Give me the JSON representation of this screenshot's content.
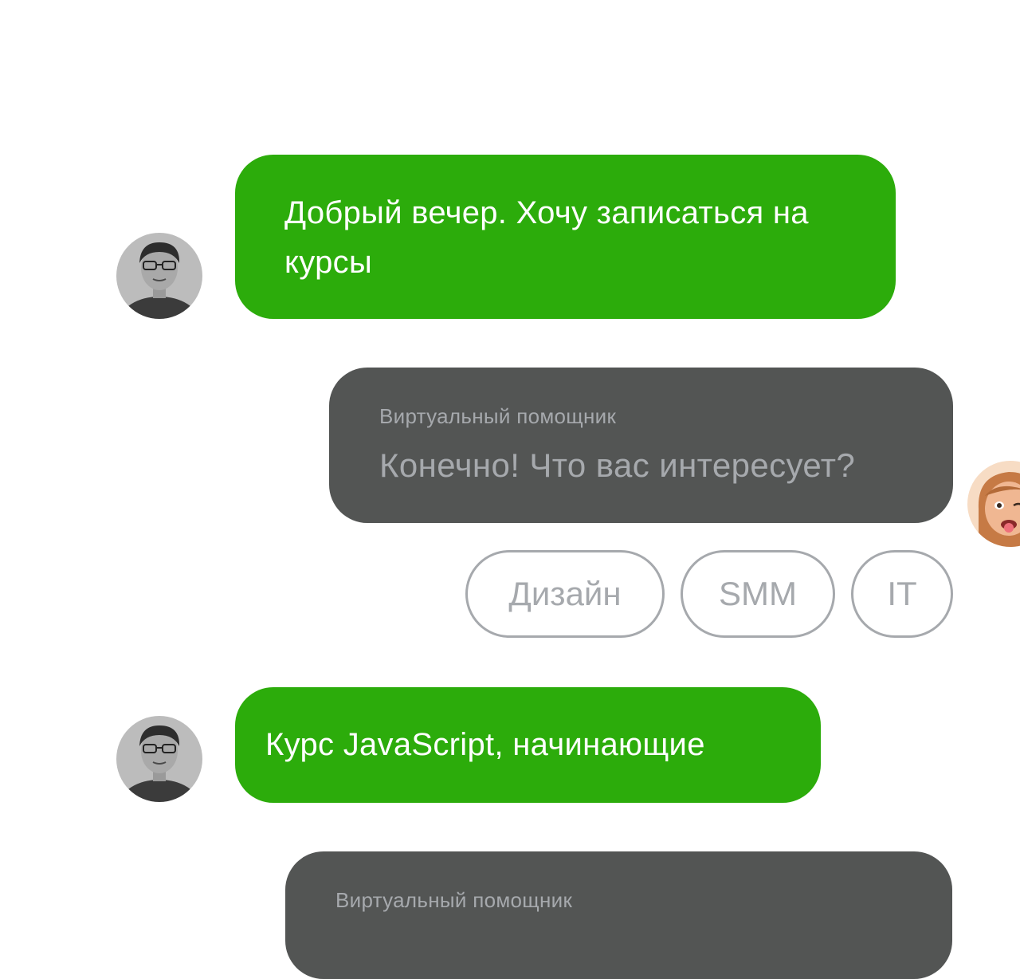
{
  "chat": {
    "messages": [
      {
        "role": "user",
        "text": "Добрый вечер. Хочу записаться на курсы"
      },
      {
        "role": "bot",
        "sender": "Виртуальный помощник",
        "text": "Конечно! Что вас интересует?"
      },
      {
        "role": "user",
        "text": "Курс JavaScript, начинающие"
      },
      {
        "role": "bot",
        "sender": "Виртуальный помощник",
        "text": ""
      }
    ],
    "quick_replies": [
      "Дизайн",
      "SMM",
      "IT"
    ]
  },
  "colors": {
    "user_bubble": "#2cac0b",
    "bot_bubble": "#535554",
    "muted_text": "#a6a9ad",
    "chip_border": "#a6a9ad"
  },
  "icons": {
    "user_avatar": "user-avatar-photo",
    "bot_avatar": "assistant-avatar-memoji"
  }
}
